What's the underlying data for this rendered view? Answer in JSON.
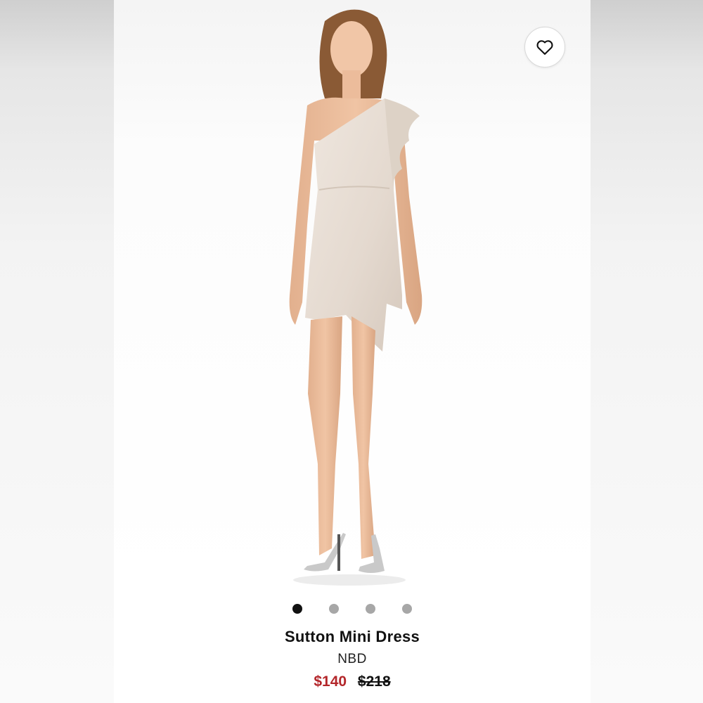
{
  "product": {
    "name": "Sutton Mini Dress",
    "brand": "NBD",
    "sale_price": "$140",
    "original_price": "$218"
  },
  "gallery": {
    "image_count": 4,
    "active_index": 0
  },
  "favorite": {
    "icon": "heart-outline-icon"
  },
  "colors": {
    "sale_price": "#b3262a",
    "dot_active": "#111111",
    "dot_inactive": "#a7a7a7",
    "dress": "#e9e0d8"
  }
}
